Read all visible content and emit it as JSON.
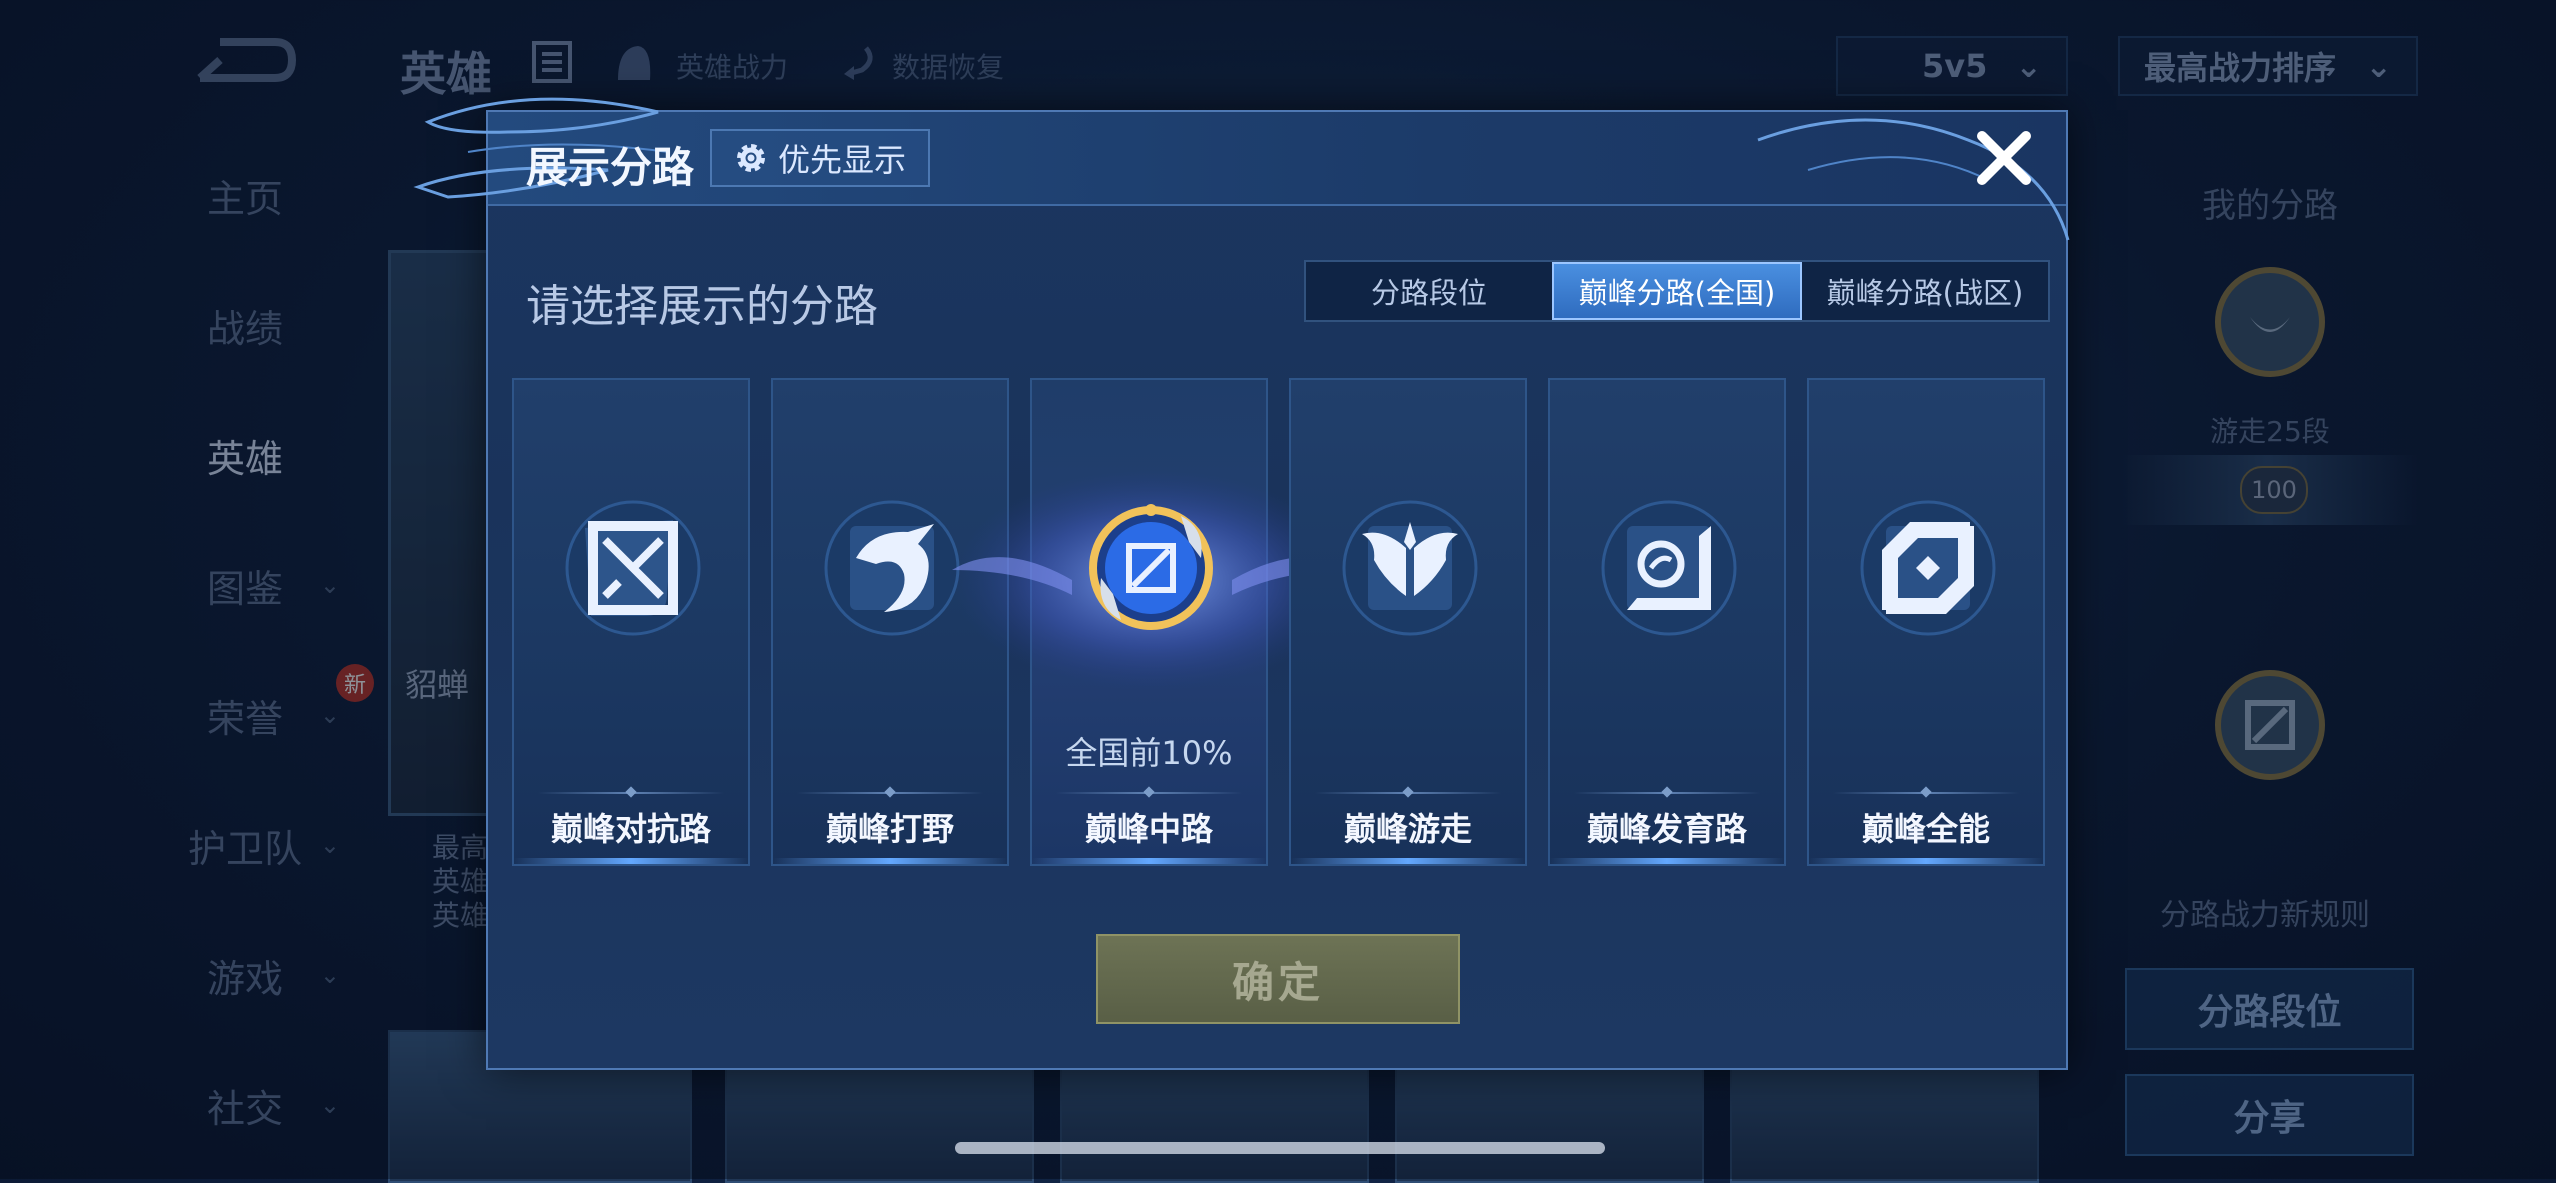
{
  "topbar": {
    "title": "英雄",
    "hero_power_link": "英雄战力",
    "data_restore_link": "数据恢复",
    "mode_select": "5v5",
    "sort_select": "最高战力排序"
  },
  "sidebar": {
    "items": [
      {
        "label": "主页"
      },
      {
        "label": "战绩"
      },
      {
        "label": "英雄"
      },
      {
        "label": "图鉴"
      },
      {
        "label": "荣誉"
      },
      {
        "label": "护卫队"
      },
      {
        "label": "游戏"
      },
      {
        "label": "社交"
      }
    ],
    "new_badge": "新"
  },
  "hero_card": {
    "name": "貂蝉",
    "lines": [
      "最高",
      "英雄",
      "英雄"
    ]
  },
  "right_panel": {
    "title": "我的分路",
    "rank": "游走25段",
    "rank_badge": "100",
    "rule_text": "分路战力新规则",
    "lane_rank_button": "分路段位",
    "share_button": "分享"
  },
  "modal": {
    "title": "展示分路",
    "pref_button": "优先显示",
    "subtitle": "请选择展示的分路",
    "tabs": [
      {
        "label": "分路段位",
        "active": false
      },
      {
        "label": "巅峰分路(全国)",
        "active": true
      },
      {
        "label": "巅峰分路(战区)",
        "active": false
      }
    ],
    "lanes": [
      {
        "label": "巅峰对抗路",
        "icon": "clash-lane-icon",
        "rank": ""
      },
      {
        "label": "巅峰打野",
        "icon": "jungle-dragon-icon",
        "rank": ""
      },
      {
        "label": "巅峰中路",
        "icon": "mid-lane-medal-icon",
        "rank": "全国前10%"
      },
      {
        "label": "巅峰游走",
        "icon": "roam-wings-icon",
        "rank": ""
      },
      {
        "label": "巅峰发育路",
        "icon": "farm-lane-icon",
        "rank": ""
      },
      {
        "label": "巅峰全能",
        "icon": "all-round-icon",
        "rank": ""
      }
    ],
    "confirm_button": "确定"
  },
  "colors": {
    "modal_bg": "#1b3660",
    "active_tab": "#3f80d6",
    "confirm_bg": "#6d7355"
  }
}
